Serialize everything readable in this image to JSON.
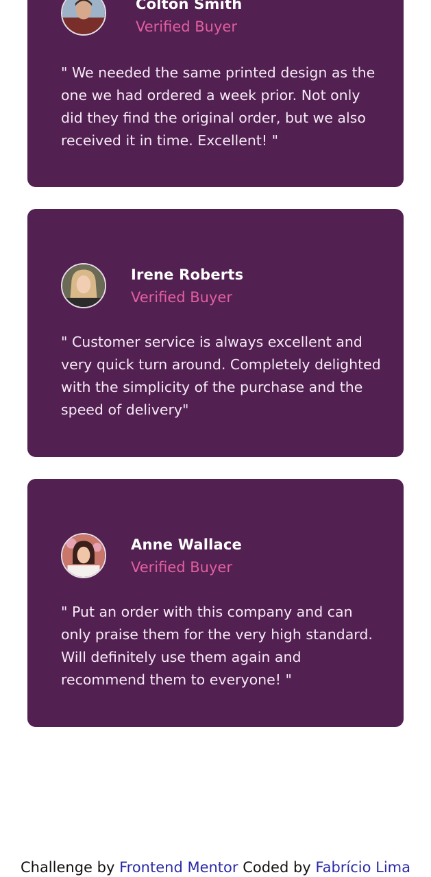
{
  "testimonials": [
    {
      "name": "Colton Smith",
      "role": "Verified Buyer",
      "quote": "\" We needed the same printed design as the one we had ordered a week prior. Not only did they find the original order, but we also received it in time. Excellent! \""
    },
    {
      "name": "Irene Roberts",
      "role": "Verified Buyer",
      "quote": "\" Customer service is always excellent and very quick turn around. Completely delighted with the simplicity of the purchase and the speed of delivery\""
    },
    {
      "name": "Anne Wallace",
      "role": "Verified Buyer",
      "quote": "\" Put an order with this company and can only praise them for the very high standard. Will definitely use them again and recommend them to everyone! \""
    }
  ],
  "footer": {
    "challenge_text": "Challenge by",
    "challenge_link": "Frontend Mentor",
    "coded_text": "Coded by",
    "coded_link": "Fabrício Lima"
  },
  "colors": {
    "card_bg": "#522051",
    "role_pink": "#e25fa0",
    "link_blue": "#2a2aa8"
  }
}
